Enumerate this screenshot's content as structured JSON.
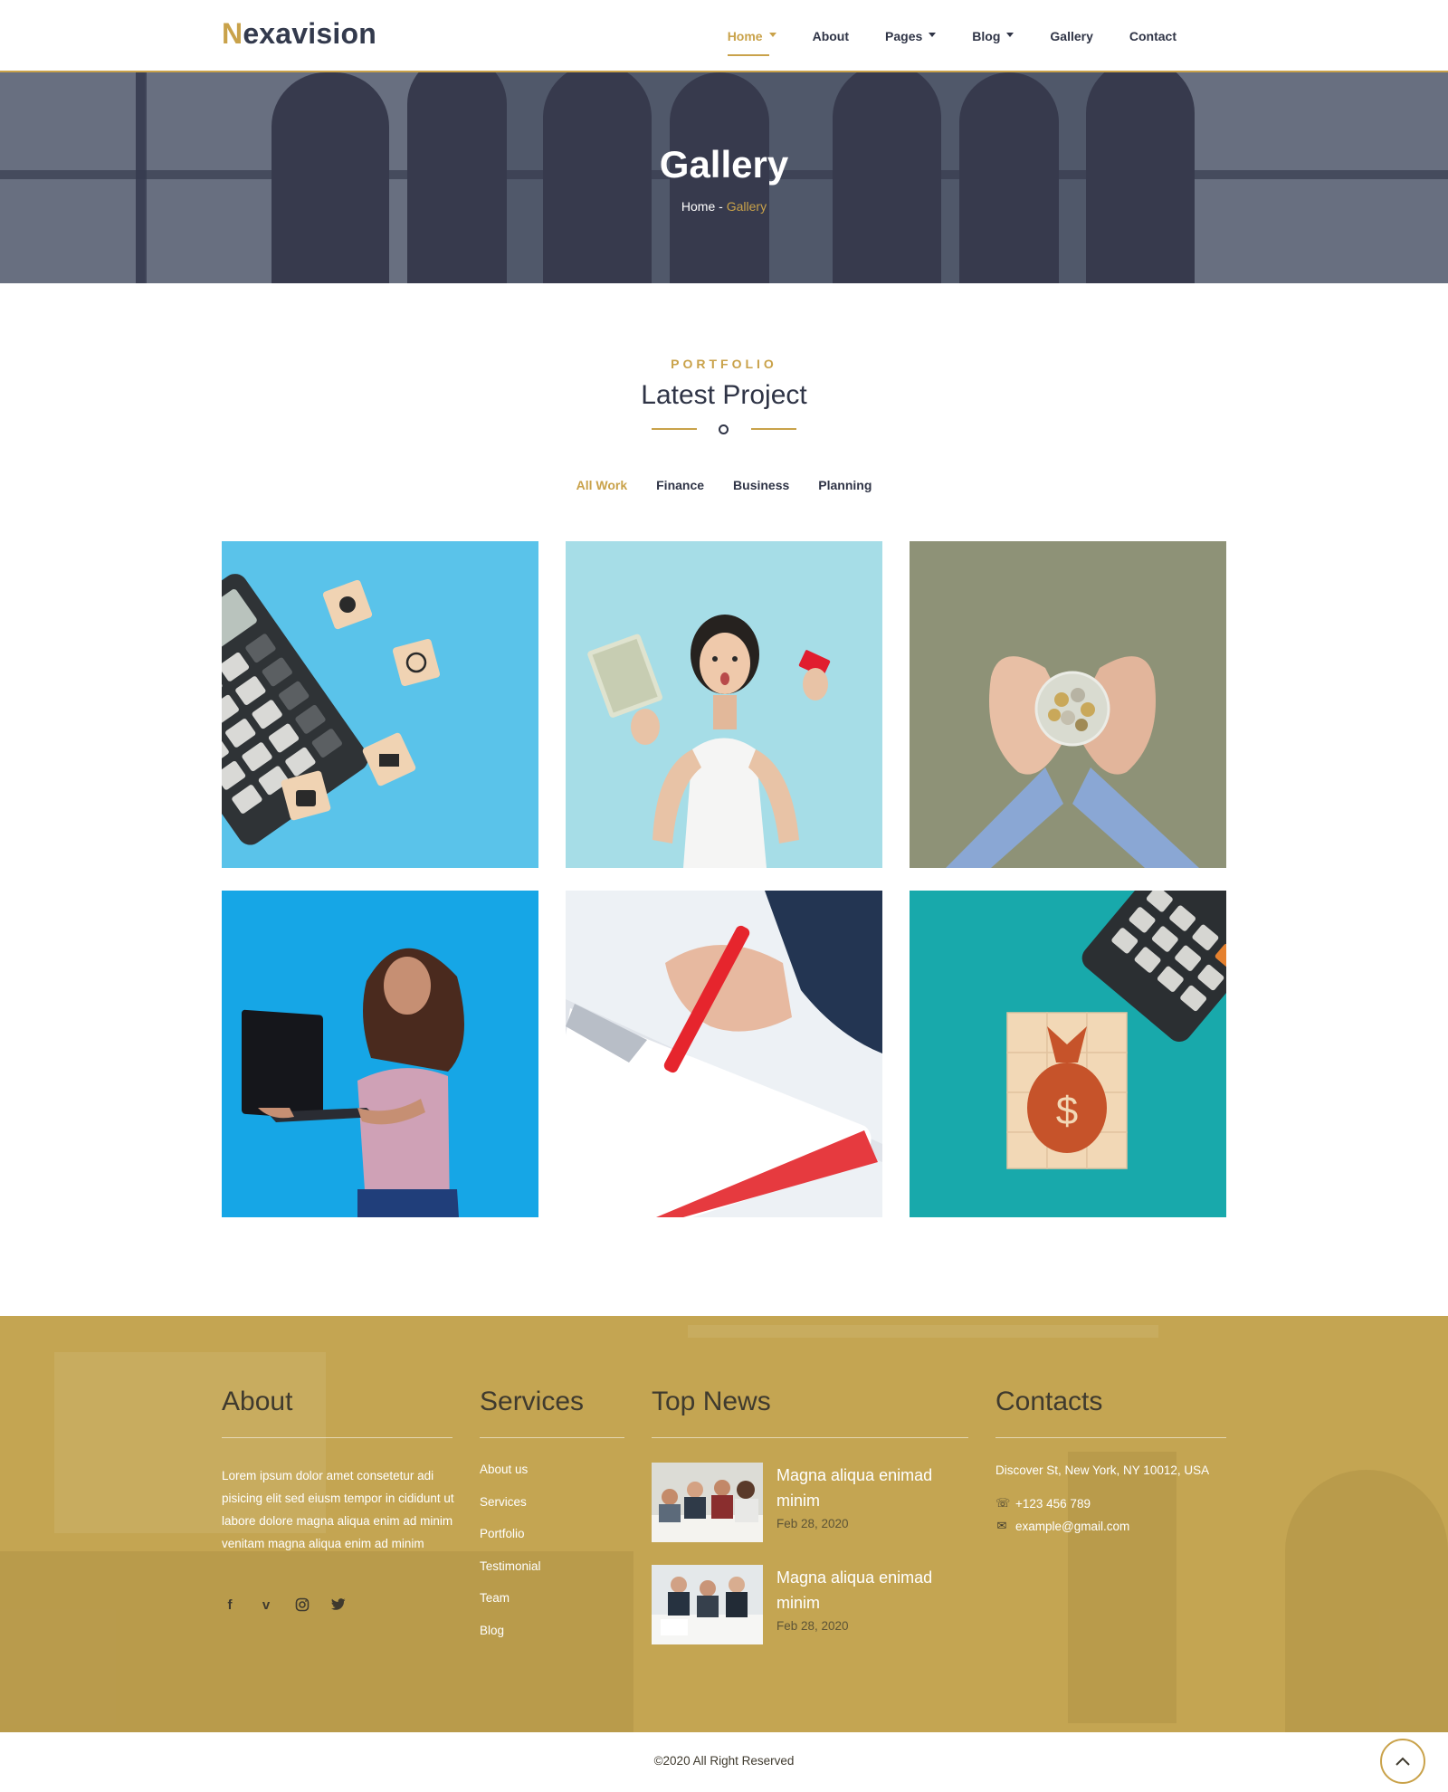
{
  "header": {
    "logo_first": "N",
    "logo_rest": "exavision",
    "nav": [
      {
        "label": "Home",
        "dropdown": true,
        "active": true
      },
      {
        "label": "About",
        "dropdown": false
      },
      {
        "label": "Pages",
        "dropdown": true
      },
      {
        "label": "Blog",
        "dropdown": true
      },
      {
        "label": "Gallery",
        "dropdown": false
      },
      {
        "label": "Contact",
        "dropdown": false
      }
    ]
  },
  "hero": {
    "title": "Gallery",
    "breadcrumb_home": "Home",
    "breadcrumb_sep": " - ",
    "breadcrumb_current": "Gallery"
  },
  "portfolio": {
    "kicker": "PORTFOLIO",
    "title": "Latest Project",
    "filters": [
      "All Work",
      "Finance",
      "Business",
      "Planning"
    ],
    "active_filter": "All Work",
    "items": [
      "calculator-and-wooden-blocks-on-blue",
      "surprised-woman-with-cash-and-card",
      "hands-holding-jar-of-coins",
      "woman-with-laptop-on-blue",
      "hand-writing-on-clipboard",
      "money-bag-blocks-and-calculator-on-teal"
    ]
  },
  "footer": {
    "about": {
      "title": "About",
      "text": "Lorem ipsum dolor amet consetetur adi pisicing elit sed eiusm tempor in cididunt ut labore dolore magna aliqua enim ad minim venitam magna aliqua enim ad minim"
    },
    "services": {
      "title": "Services",
      "links": [
        "About us",
        "Services",
        "Portfolio",
        "Testimonial",
        "Team",
        "Blog"
      ]
    },
    "news": {
      "title": "Top News",
      "items": [
        {
          "title": "Magna aliqua enimad minim",
          "date": "Feb 28, 2020"
        },
        {
          "title": "Magna aliqua enimad minim",
          "date": "Feb 28, 2020"
        }
      ]
    },
    "contacts": {
      "title": "Contacts",
      "address": "Discover St, New York, NY 10012, USA",
      "phone": "+123 456 789",
      "email": "example@gmail.com"
    },
    "social_icons": [
      "facebook-icon",
      "vimeo-icon",
      "instagram-icon",
      "twitter-icon"
    ],
    "copyright": "©2020 All Right Reserved"
  },
  "colors": {
    "accent": "#c9a24a",
    "dark": "#2f3446",
    "footer_bg": "#c4a552"
  }
}
